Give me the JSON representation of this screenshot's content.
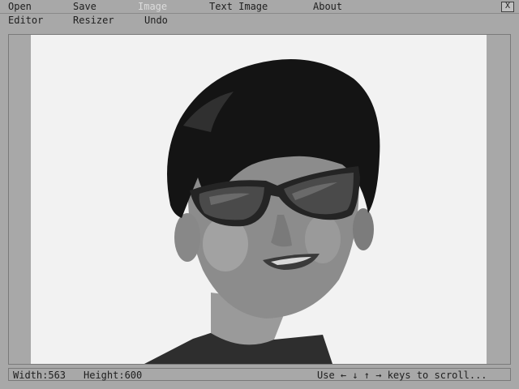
{
  "menu": {
    "row1": [
      "Open",
      "Save",
      "Image",
      "Text Image",
      "About"
    ],
    "row2": [
      "Editor",
      "Resizer",
      "Undo"
    ],
    "close_label": "X"
  },
  "image": {
    "description_icon": "portrait-photo-icon"
  },
  "status": {
    "width_label": "Width:563",
    "height_label": "Height:600",
    "hint": "Use ← ↓ ↑ → keys to scroll..."
  }
}
